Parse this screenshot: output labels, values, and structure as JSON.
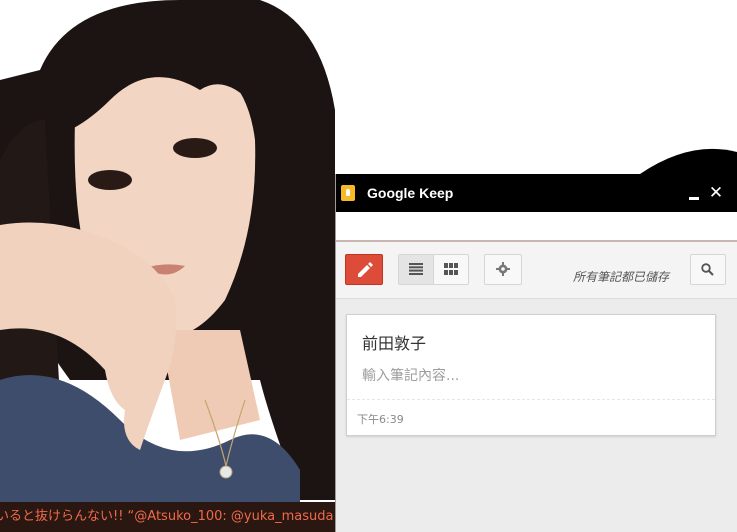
{
  "wallpaper": {
    "ticker_text": "いると抜けらんない!! “@Atsuko_100: @yuka_masuda 愛の"
  },
  "window": {
    "title": "Google Keep",
    "icon": "keep-bulb-icon",
    "accent_color": "#dd4b39",
    "icon_color": "#f7b928"
  },
  "toolbar": {
    "new_note_icon": "pencil-icon",
    "list_view_icon": "list-view-icon",
    "grid_view_icon": "grid-view-icon",
    "settings_icon": "gear-icon",
    "saved_status": "所有筆記都已儲存",
    "search_icon": "search-icon"
  },
  "note": {
    "title": "前田敦子",
    "placeholder": "輸入筆記內容...",
    "time": "下午6:39"
  }
}
